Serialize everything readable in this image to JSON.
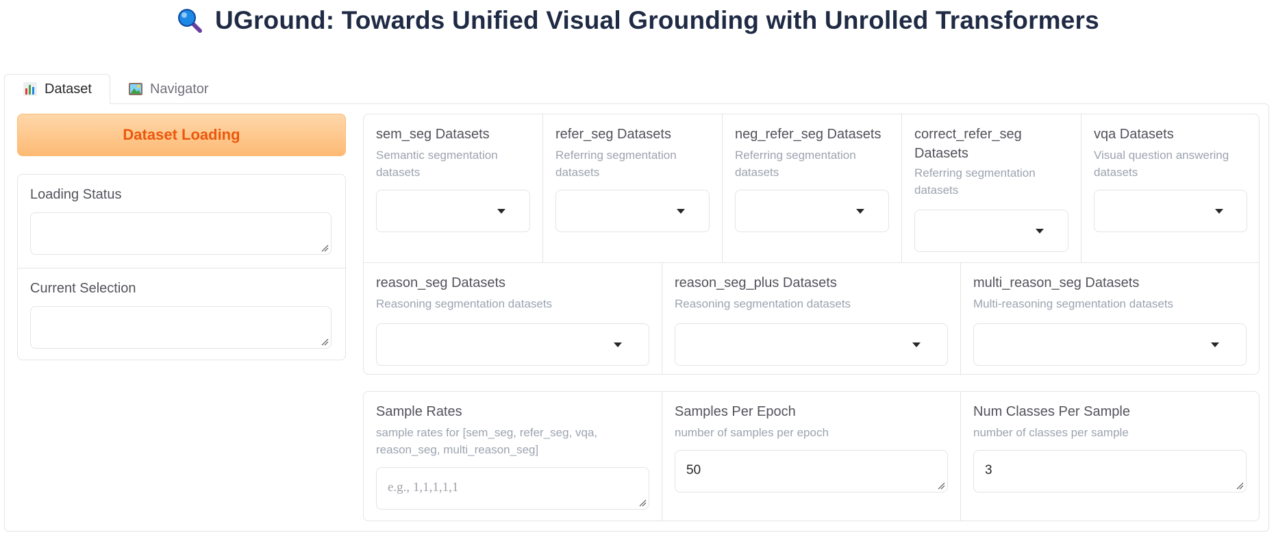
{
  "title": {
    "icon": "magnifier-icon",
    "text": "UGround: Towards Unified Visual Grounding with Unrolled Transformers"
  },
  "tabs": [
    {
      "label": "Dataset",
      "icon": "bar-chart-icon",
      "active": true
    },
    {
      "label": "Navigator",
      "icon": "picture-icon",
      "active": false
    }
  ],
  "left": {
    "load_button": "Dataset Loading",
    "loading_status": {
      "label": "Loading Status",
      "value": ""
    },
    "current_selection": {
      "label": "Current Selection",
      "value": ""
    }
  },
  "datasets": {
    "row1": [
      {
        "label": "sem_seg Datasets",
        "desc": "Semantic segmentation datasets"
      },
      {
        "label": "refer_seg Datasets",
        "desc": "Referring segmentation datasets"
      },
      {
        "label": "neg_refer_seg Datasets",
        "desc": "Referring segmentation datasets"
      },
      {
        "label": "correct_refer_seg Datasets",
        "desc": "Referring segmentation datasets"
      },
      {
        "label": "vqa Datasets",
        "desc": "Visual question answering datasets"
      }
    ],
    "row2": [
      {
        "label": "reason_seg Datasets",
        "desc": "Reasoning segmentation datasets"
      },
      {
        "label": "reason_seg_plus Datasets",
        "desc": "Reasoning segmentation datasets"
      },
      {
        "label": "multi_reason_seg Datasets",
        "desc": "Multi-reasoning segmentation datasets"
      }
    ]
  },
  "params": [
    {
      "label": "Sample Rates",
      "desc": "sample rates for [sem_seg, refer_seg, vqa, reason_seg, multi_reason_seg]",
      "value": "",
      "placeholder": "e.g., 1,1,1,1,1"
    },
    {
      "label": "Samples Per Epoch",
      "desc": "number of samples per epoch",
      "value": "50",
      "placeholder": ""
    },
    {
      "label": "Num Classes Per Sample",
      "desc": "number of classes per sample",
      "value": "3",
      "placeholder": ""
    }
  ],
  "colors": {
    "accent": "#ea580c",
    "accent_bg": "#fdba74",
    "border": "#e4e4e7",
    "title": "#1f2a44"
  }
}
